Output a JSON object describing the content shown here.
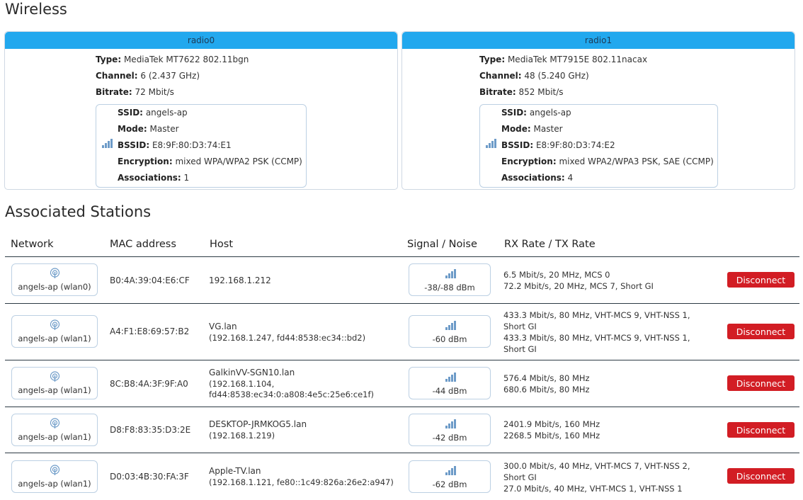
{
  "header": {
    "title": "Wireless"
  },
  "radios": [
    {
      "name": "radio0",
      "type_label": "Type:",
      "type": "MediaTek MT7622 802.11bgn",
      "channel_label": "Channel:",
      "channel": "6 (2.437 GHz)",
      "bitrate_label": "Bitrate:",
      "bitrate": "72 Mbit/s",
      "network": {
        "ssid_label": "SSID:",
        "ssid": "angels-ap",
        "mode_label": "Mode:",
        "mode": "Master",
        "bssid_label": "BSSID:",
        "bssid": "E8:9F:80:D3:74:E1",
        "encryption_label": "Encryption:",
        "encryption": "mixed WPA/WPA2 PSK (CCMP)",
        "associations_label": "Associations:",
        "associations": "1",
        "signal_icon": "signal-bars-icon"
      }
    },
    {
      "name": "radio1",
      "type_label": "Type:",
      "type": "MediaTek MT7915E 802.11nacax",
      "channel_label": "Channel:",
      "channel": "48 (5.240 GHz)",
      "bitrate_label": "Bitrate:",
      "bitrate": "852 Mbit/s",
      "network": {
        "ssid_label": "SSID:",
        "ssid": "angels-ap",
        "mode_label": "Mode:",
        "mode": "Master",
        "bssid_label": "BSSID:",
        "bssid": "E8:9F:80:D3:74:E2",
        "encryption_label": "Encryption:",
        "encryption": "mixed WPA2/WPA3 PSK, SAE (CCMP)",
        "associations_label": "Associations:",
        "associations": "4",
        "signal_icon": "signal-bars-icon"
      }
    }
  ],
  "stations": {
    "title": "Associated Stations",
    "columns": {
      "network": "Network",
      "mac": "MAC address",
      "host": "Host",
      "signal": "Signal / Noise",
      "rate": "RX Rate / TX Rate"
    },
    "disconnect_label": "Disconnect",
    "rows": [
      {
        "network": "angels-ap (wlan0)",
        "mac": "B0:4A:39:04:E6:CF",
        "host": "192.168.1.212",
        "host_detail": "",
        "signal": "-38/-88 dBm",
        "rate_lines": [
          "6.5 Mbit/s, 20 MHz, MCS 0",
          "72.2 Mbit/s, 20 MHz, MCS 7, Short GI"
        ]
      },
      {
        "network": "angels-ap (wlan1)",
        "mac": "A4:F1:E8:69:57:B2",
        "host": "VG.lan",
        "host_detail": "(192.168.1.247, fd44:8538:ec34::bd2)",
        "signal": "-60 dBm",
        "rate_lines": [
          "433.3 Mbit/s, 80 MHz, VHT-MCS 9, VHT-NSS 1,",
          "Short GI",
          "433.3 Mbit/s, 80 MHz, VHT-MCS 9, VHT-NSS 1,",
          "Short GI"
        ]
      },
      {
        "network": "angels-ap (wlan1)",
        "mac": "8C:B8:4A:3F:9F:A0",
        "host": "GalkinVV-SGN10.lan",
        "host_detail": "(192.168.1.104,",
        "host_detail2": "fd44:8538:ec34:0:a808:4e5c:25e6:ce1f)",
        "signal": "-44 dBm",
        "rate_lines": [
          "576.4 Mbit/s, 80 MHz",
          "680.6 Mbit/s, 80 MHz"
        ]
      },
      {
        "network": "angels-ap (wlan1)",
        "mac": "D8:F8:83:35:D3:2E",
        "host": "DESKTOP-JRMKOG5.lan",
        "host_detail": "(192.168.1.219)",
        "signal": "-42 dBm",
        "rate_lines": [
          "2401.9 Mbit/s, 160 MHz",
          "2268.5 Mbit/s, 160 MHz"
        ]
      },
      {
        "network": "angels-ap (wlan1)",
        "mac": "D0:03:4B:30:FA:3F",
        "host": "Apple-TV.lan",
        "host_detail": "(192.168.1.121, fe80::1c49:826a:26e2:a947)",
        "signal": "-62 dBm",
        "rate_lines": [
          "300.0 Mbit/s, 40 MHz, VHT-MCS 7, VHT-NSS 2,",
          "Short GI",
          "27.0 Mbit/s, 40 MHz, VHT-MCS 1, VHT-NSS 1"
        ]
      }
    ]
  },
  "colors": {
    "radio_header": "#22a8ee",
    "disconnect": "#d21d24",
    "icon": "#6d9bc8"
  }
}
